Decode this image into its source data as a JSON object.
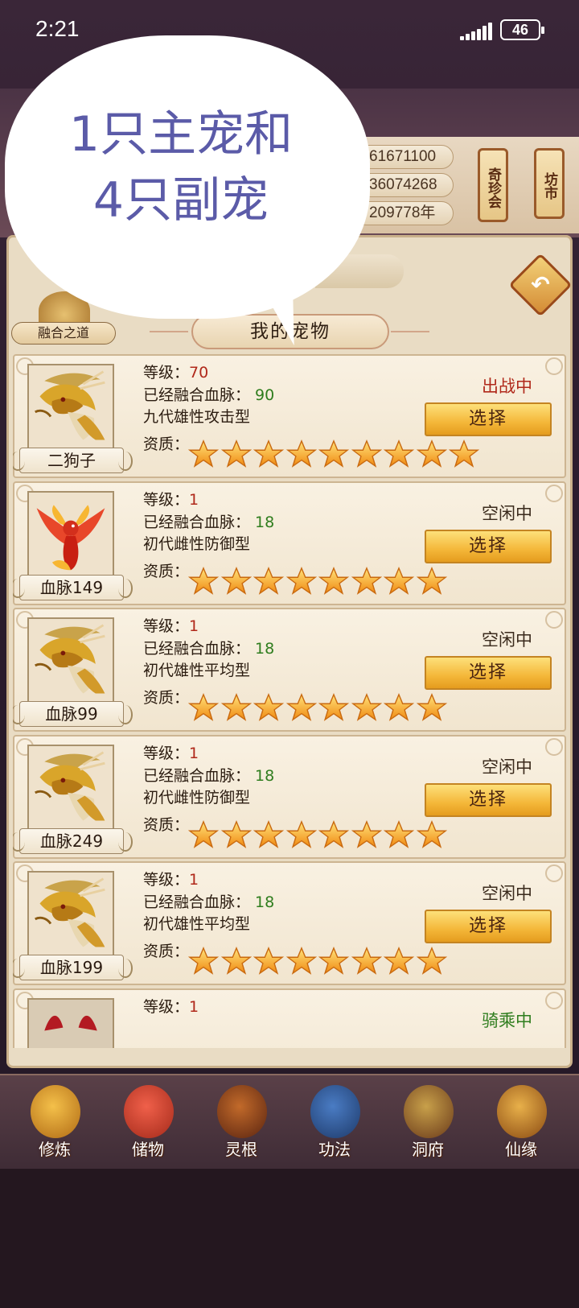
{
  "status_bar": {
    "time": "2:21",
    "battery": "46"
  },
  "resources": {
    "values": [
      "61671100",
      "36074268",
      "209778年"
    ]
  },
  "shortcuts": [
    {
      "label": "奇珍会",
      "icon": "scroll-icon"
    },
    {
      "label": "坊市",
      "icon": "scroll-icon"
    }
  ],
  "fusion": {
    "label": "融合之道"
  },
  "panel": {
    "tab_label": "我的宠物"
  },
  "labels": {
    "level": "等级：",
    "bloodline": "已经融合血脉：",
    "quality": "资质：",
    "select": "选择"
  },
  "pets": [
    {
      "name": "二狗子",
      "level": "70",
      "bloodline": "90",
      "type": "九代雄性攻击型",
      "stars": 9,
      "status": "出战中",
      "status_color": "#b0281a",
      "avatar": "golden-dragon"
    },
    {
      "name": "血脉149",
      "level": "1",
      "bloodline": "18",
      "type": "初代雌性防御型",
      "stars": 8,
      "status": "空闲中",
      "status_color": "#3a2a1c",
      "avatar": "phoenix"
    },
    {
      "name": "血脉99",
      "level": "1",
      "bloodline": "18",
      "type": "初代雄性平均型",
      "stars": 8,
      "status": "空闲中",
      "status_color": "#3a2a1c",
      "avatar": "golden-dragon"
    },
    {
      "name": "血脉249",
      "level": "1",
      "bloodline": "18",
      "type": "初代雌性防御型",
      "stars": 8,
      "status": "空闲中",
      "status_color": "#3a2a1c",
      "avatar": "golden-dragon"
    },
    {
      "name": "血脉199",
      "level": "1",
      "bloodline": "18",
      "type": "初代雄性平均型",
      "stars": 8,
      "status": "空闲中",
      "status_color": "#3a2a1c",
      "avatar": "golden-dragon"
    },
    {
      "name": "",
      "level": "1",
      "bloodline": "",
      "type": "",
      "stars": 0,
      "status": "骑乘中",
      "status_color": "#2f7d1e",
      "avatar": "red-beast"
    }
  ],
  "nav": [
    {
      "label": "修炼",
      "icon": "monk-icon"
    },
    {
      "label": "储物",
      "icon": "bag-icon"
    },
    {
      "label": "灵根",
      "icon": "spirit-root-icon"
    },
    {
      "label": "功法",
      "icon": "book-icon"
    },
    {
      "label": "洞府",
      "icon": "palace-icon"
    },
    {
      "label": "仙缘",
      "icon": "gourd-icon"
    }
  ],
  "annotation": {
    "line1": "1只主宠和",
    "line2": "4只副宠"
  }
}
